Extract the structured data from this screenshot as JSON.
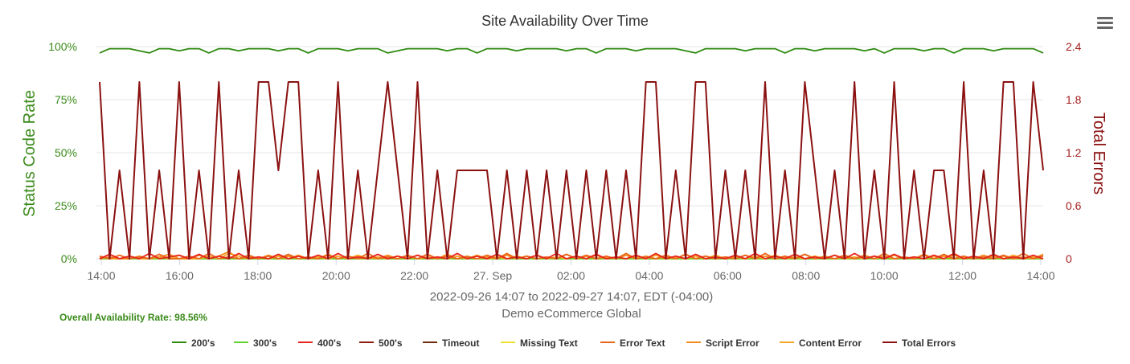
{
  "chart_data": {
    "type": "line",
    "title": "Site Availability Over Time",
    "subtitle_lines": [
      "2022-09-26 14:07 to 2022-09-27 14:07, EDT (-04:00)",
      "Demo eCommerce Global"
    ],
    "xlabels": [
      "14:00",
      "16:00",
      "18:00",
      "20:00",
      "22:00",
      "27. Sep",
      "02:00",
      "04:00",
      "06:00",
      "08:00",
      "10:00",
      "12:00",
      "14:00"
    ],
    "ylabel_left": "Status Code Rate",
    "ylabel_right": "Total Errors",
    "yticks_left": [
      "0%",
      "25%",
      "50%",
      "75%",
      "100%"
    ],
    "yticks_right": [
      "0",
      "0.6",
      "1.2",
      "1.8",
      "2.4"
    ],
    "ylim_left": [
      0,
      100
    ],
    "ylim_right": [
      0,
      2.4
    ],
    "x_start": "2022-09-26 14:07",
    "x_end": "2022-09-27 14:07",
    "grid": true,
    "legend_position": "bottom",
    "footer_note": "Overall Availability Rate: 98.56%",
    "series": [
      {
        "name": "200's",
        "axis": "left",
        "color": "#2d8a0f",
        "values": [
          97,
          99,
          99,
          99,
          98,
          97,
          99,
          99,
          98,
          99,
          99,
          97,
          99,
          99,
          98,
          99,
          99,
          99,
          98,
          99,
          99,
          97,
          99,
          99,
          99,
          98,
          99,
          99,
          99,
          97,
          98,
          99,
          99,
          99,
          99,
          98,
          99,
          99,
          97,
          99,
          99,
          99,
          98,
          99,
          99,
          99,
          99,
          98,
          99,
          99,
          97,
          99,
          99,
          99,
          98,
          99,
          99,
          99,
          99,
          98,
          97,
          99,
          99,
          99,
          99,
          98,
          99,
          99,
          99,
          97,
          99,
          99,
          98,
          99,
          99,
          99,
          99,
          98,
          99,
          97,
          99,
          99,
          99,
          98,
          99,
          99,
          97,
          99,
          99,
          99,
          98,
          99,
          99,
          99,
          99,
          97
        ]
      },
      {
        "name": "300's",
        "axis": "right",
        "color": "#5fd22b",
        "values": [
          0,
          0,
          0,
          0,
          0,
          0,
          0,
          0,
          0,
          0,
          0,
          0,
          0,
          0,
          0,
          0,
          0,
          0,
          0,
          0,
          0,
          0,
          0,
          0,
          0,
          0,
          0,
          0,
          0,
          0,
          0,
          0,
          0,
          0,
          0,
          0,
          0,
          0,
          0,
          0,
          0,
          0,
          0,
          0,
          0,
          0,
          0,
          0,
          0,
          0,
          0,
          0,
          0,
          0,
          0,
          0,
          0,
          0,
          0,
          0,
          0,
          0,
          0,
          0,
          0,
          0,
          0,
          0,
          0,
          0,
          0,
          0,
          0,
          0,
          0,
          0,
          0,
          0,
          0,
          0,
          0,
          0,
          0,
          0,
          0,
          0,
          0,
          0,
          0,
          0,
          0,
          0,
          0,
          0,
          0,
          0
        ]
      },
      {
        "name": "400's",
        "axis": "right",
        "color": "#e8251b",
        "values": [
          0,
          0.05,
          0,
          0.03,
          0,
          0.06,
          0,
          0.02,
          0.04,
          0,
          0.05,
          0,
          0.03,
          0,
          0.06,
          0,
          0.02,
          0,
          0.05,
          0,
          0.03,
          0,
          0.04,
          0,
          0.06,
          0,
          0.02,
          0,
          0.05,
          0,
          0.03,
          0,
          0.04,
          0,
          0.02,
          0,
          0.06,
          0,
          0.03,
          0,
          0.05,
          0,
          0.02,
          0,
          0.04,
          0,
          0.06,
          0,
          0.03,
          0,
          0.05,
          0,
          0.02,
          0,
          0.04,
          0,
          0.06,
          0,
          0.03,
          0,
          0.05,
          0,
          0.02,
          0,
          0.04,
          0,
          0.06,
          0,
          0.03,
          0,
          0.05,
          0,
          0.02,
          0,
          0.04,
          0,
          0.06,
          0,
          0.03,
          0,
          0.05,
          0,
          0.02,
          0,
          0.04,
          0,
          0.06,
          0,
          0.03,
          0,
          0.05,
          0,
          0.02,
          0,
          0.04,
          0
        ]
      },
      {
        "name": "500's",
        "axis": "right",
        "color": "#8b1a0e",
        "values": [
          0,
          0,
          0,
          0,
          0,
          0,
          0,
          0,
          0,
          0,
          0,
          0,
          0,
          0,
          0,
          0,
          0,
          0,
          0,
          0,
          0,
          0,
          0,
          0,
          0,
          0,
          0,
          0,
          0,
          0,
          0,
          0,
          0,
          0,
          0,
          0,
          0,
          0,
          0,
          0,
          0,
          0,
          0,
          0,
          0,
          0,
          0,
          0,
          0,
          0,
          0,
          0,
          0,
          0,
          0,
          0,
          0,
          0,
          0,
          0,
          0,
          0,
          0,
          0,
          0,
          0,
          0,
          0,
          0,
          0,
          0,
          0,
          0,
          0,
          0,
          0,
          0,
          0,
          0,
          0,
          0,
          0,
          0,
          0,
          0,
          0,
          0,
          0,
          0,
          0,
          0,
          0,
          0,
          0,
          0,
          0
        ]
      },
      {
        "name": "Timeout",
        "axis": "right",
        "color": "#6e2c0a",
        "values": [
          0,
          0,
          0,
          0,
          0,
          0,
          0,
          0,
          0,
          0,
          0,
          0,
          0,
          0,
          0,
          0,
          0,
          0,
          0,
          0,
          0,
          0,
          0,
          0,
          0,
          0,
          0,
          0,
          0,
          0,
          0,
          0,
          0,
          0,
          0,
          0,
          0,
          0,
          0,
          0,
          0,
          0,
          0,
          0,
          0,
          0,
          0,
          0,
          0,
          0,
          0,
          0,
          0,
          0,
          0,
          0,
          0,
          0,
          0,
          0,
          0,
          0,
          0,
          0,
          0,
          0,
          0,
          0,
          0,
          0,
          0,
          0,
          0,
          0,
          0,
          0,
          0,
          0,
          0,
          0,
          0,
          0,
          0,
          0,
          0,
          0,
          0,
          0,
          0,
          0,
          0,
          0,
          0,
          0,
          0,
          0
        ]
      },
      {
        "name": "Missing Text",
        "axis": "right",
        "color": "#f0e02a",
        "values": [
          0,
          0,
          0,
          0,
          0,
          0,
          0,
          0,
          0,
          0,
          0,
          0,
          0,
          0,
          0,
          0,
          0,
          0,
          0,
          0,
          0,
          0,
          0,
          0,
          0,
          0,
          0,
          0,
          0,
          0,
          0,
          0,
          0,
          0,
          0,
          0,
          0,
          0,
          0,
          0,
          0,
          0,
          0,
          0,
          0,
          0,
          0,
          0,
          0,
          0,
          0,
          0,
          0,
          0,
          0,
          0,
          0,
          0,
          0,
          0,
          0,
          0,
          0,
          0,
          0,
          0,
          0,
          0,
          0,
          0,
          0,
          0,
          0,
          0,
          0,
          0,
          0,
          0,
          0,
          0,
          0,
          0,
          0,
          0,
          0,
          0,
          0,
          0,
          0,
          0,
          0,
          0,
          0,
          0,
          0,
          0
        ]
      },
      {
        "name": "Error Text",
        "axis": "right",
        "color": "#e8661b",
        "values": [
          0.03,
          0,
          0.04,
          0,
          0.02,
          0,
          0.05,
          0,
          0,
          0.03,
          0,
          0.06,
          0,
          0.02,
          0,
          0.04,
          0,
          0.03,
          0,
          0.05,
          0,
          0.02,
          0,
          0.04,
          0,
          0.03,
          0,
          0.06,
          0,
          0.02,
          0,
          0.04,
          0,
          0.05,
          0,
          0.03,
          0,
          0.02,
          0,
          0.04,
          0,
          0.06,
          0,
          0.03,
          0,
          0.02,
          0,
          0.05,
          0,
          0.04,
          0,
          0.03,
          0,
          0.06,
          0,
          0.02,
          0,
          0.04,
          0,
          0.05,
          0,
          0.03,
          0,
          0.02,
          0,
          0.04,
          0,
          0.06,
          0,
          0.03,
          0,
          0.05,
          0,
          0.02,
          0,
          0.04,
          0,
          0.03,
          0,
          0.06,
          0,
          0.02,
          0,
          0.04,
          0,
          0.05,
          0,
          0.03,
          0,
          0.02,
          0,
          0.04,
          0,
          0.06,
          0,
          0.03
        ]
      },
      {
        "name": "Script Error",
        "axis": "right",
        "color": "#f28a1e",
        "values": [
          0,
          0.02,
          0,
          0,
          0.03,
          0,
          0.02,
          0.05,
          0,
          0,
          0.04,
          0,
          0.03,
          0.08,
          0,
          0.02,
          0,
          0.04,
          0,
          0.03,
          0,
          0.02,
          0,
          0.05,
          0,
          0.03,
          0,
          0.02,
          0,
          0.04,
          0,
          0.03,
          0,
          0.02,
          0,
          0.05,
          0,
          0.03,
          0,
          0.02,
          0,
          0.04,
          0,
          0.03,
          0,
          0.02,
          0,
          0.05,
          0,
          0.03,
          0,
          0.02,
          0,
          0.04,
          0,
          0.03,
          0,
          0.02,
          0,
          0.05,
          0,
          0.03,
          0,
          0.02,
          0,
          0.04,
          0,
          0.03,
          0,
          0.02,
          0,
          0.05,
          0,
          0.03,
          0,
          0.02,
          0,
          0.04,
          0,
          0.03,
          0,
          0.02,
          0,
          0.05,
          0,
          0.03,
          0,
          0.02,
          0,
          0.04,
          0,
          0.03,
          0,
          0.02,
          0,
          0.05
        ]
      },
      {
        "name": "Content Error",
        "axis": "right",
        "color": "#f5a623",
        "values": [
          0.02,
          0,
          0,
          0.03,
          0,
          0,
          0.02,
          0,
          0.04,
          0,
          0,
          0.03,
          0,
          0.06,
          0.03,
          0,
          0.02,
          0,
          0.03,
          0,
          0.04,
          0,
          0.02,
          0,
          0.03,
          0,
          0.04,
          0,
          0.02,
          0,
          0.03,
          0,
          0.04,
          0,
          0.02,
          0,
          0.03,
          0,
          0.04,
          0,
          0.02,
          0,
          0.03,
          0,
          0.04,
          0,
          0.02,
          0,
          0.03,
          0,
          0.04,
          0,
          0.02,
          0,
          0.03,
          0,
          0.04,
          0,
          0.02,
          0,
          0.03,
          0,
          0.04,
          0,
          0.02,
          0,
          0.03,
          0,
          0.04,
          0,
          0.02,
          0,
          0.03,
          0,
          0.04,
          0,
          0.02,
          0,
          0.03,
          0,
          0.04,
          0,
          0.02,
          0,
          0.03,
          0,
          0.04,
          0,
          0.02,
          0,
          0.03,
          0,
          0.04,
          0,
          0.02,
          0
        ]
      },
      {
        "name": "Total Errors",
        "axis": "right",
        "color": "#8b1111",
        "values": [
          2,
          0,
          1,
          0,
          2,
          0,
          1,
          0,
          2,
          0,
          1,
          0,
          2,
          0,
          1,
          0,
          2,
          2,
          1,
          2,
          2,
          0,
          1,
          0,
          2,
          0,
          1,
          0,
          1,
          2,
          1,
          0,
          2,
          0,
          1,
          0,
          1,
          1,
          1,
          1,
          0,
          1,
          0,
          1,
          0,
          1,
          0,
          1,
          0,
          1,
          0,
          1,
          0,
          1,
          0,
          2,
          2,
          0,
          1,
          0,
          2,
          2,
          0,
          1,
          0,
          1,
          0,
          2,
          0,
          1,
          0,
          2,
          1,
          0,
          1,
          0,
          2,
          0,
          1,
          0,
          2,
          0,
          1,
          0,
          1,
          1,
          0,
          2,
          0,
          1,
          0,
          2,
          2,
          0,
          2,
          1
        ]
      }
    ]
  }
}
